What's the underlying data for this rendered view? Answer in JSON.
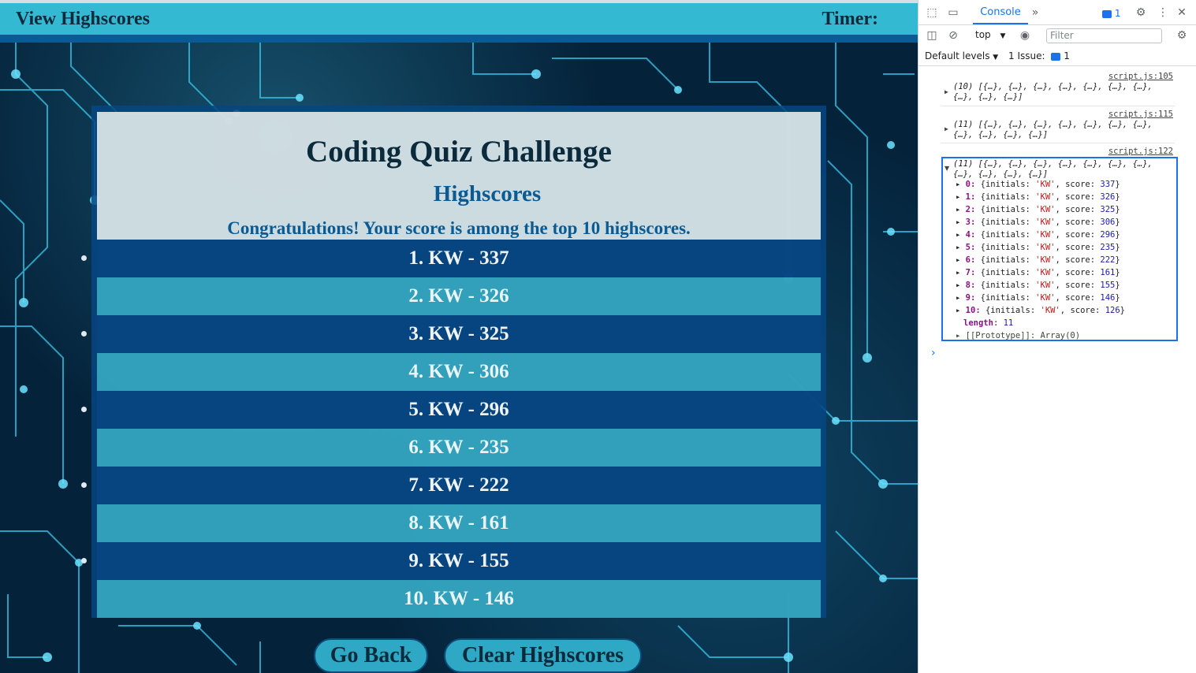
{
  "header": {
    "view_highscores": "View Highscores",
    "timer_label": "Timer:"
  },
  "quiz": {
    "title": "Coding Quiz Challenge",
    "subtitle": "Highscores",
    "message": "Congratulations! Your score is among the top 10 highscores.",
    "scores": [
      "1. KW - 337",
      "2. KW - 326",
      "3. KW - 325",
      "4. KW - 306",
      "5. KW - 296",
      "6. KW - 235",
      "7. KW - 222",
      "8. KW - 161",
      "9. KW - 155",
      "10. KW - 146"
    ]
  },
  "buttons": {
    "go_back": "Go Back",
    "clear": "Clear Highscores"
  },
  "devtools": {
    "tab": "Console",
    "issue_badge": "1",
    "context": "top",
    "filter_placeholder": "Filter",
    "levels": "Default levels",
    "issues_label": "1 Issue:",
    "issues_count": "1",
    "logs": [
      {
        "source": "script.js:105",
        "text": "(10) [{…}, {…}, {…}, {…}, {…}, {…}, {…}, {…}, {…}, {…}]"
      },
      {
        "source": "script.js:115",
        "text": "(11) [{…}, {…}, {…}, {…}, {…}, {…}, {…}, {…}, {…}, {…}, {…}]"
      },
      {
        "source": "script.js:122",
        "text": "(11) [{…}, {…}, {…}, {…}, {…}, {…}, {…}, {…}, {…}, {…}, {…}]"
      }
    ],
    "expanded": [
      {
        "key": "0",
        "initials": "'KW'",
        "score": "337"
      },
      {
        "key": "1",
        "initials": "'KW'",
        "score": "326"
      },
      {
        "key": "2",
        "initials": "'KW'",
        "score": "325"
      },
      {
        "key": "3",
        "initials": "'KW'",
        "score": "306"
      },
      {
        "key": "4",
        "initials": "'KW'",
        "score": "296"
      },
      {
        "key": "5",
        "initials": "'KW'",
        "score": "235"
      },
      {
        "key": "6",
        "initials": "'KW'",
        "score": "222"
      },
      {
        "key": "7",
        "initials": "'KW'",
        "score": "161"
      },
      {
        "key": "8",
        "initials": "'KW'",
        "score": "155"
      },
      {
        "key": "9",
        "initials": "'KW'",
        "score": "146"
      },
      {
        "key": "10",
        "initials": "'KW'",
        "score": "126"
      }
    ],
    "length_label": "length",
    "length_value": "11",
    "prototype": "[[Prototype]]: Array(0)"
  },
  "colors": {
    "header": "#33b9d1",
    "header_bar": "#0a5a93",
    "accent": "#1a73e8"
  }
}
